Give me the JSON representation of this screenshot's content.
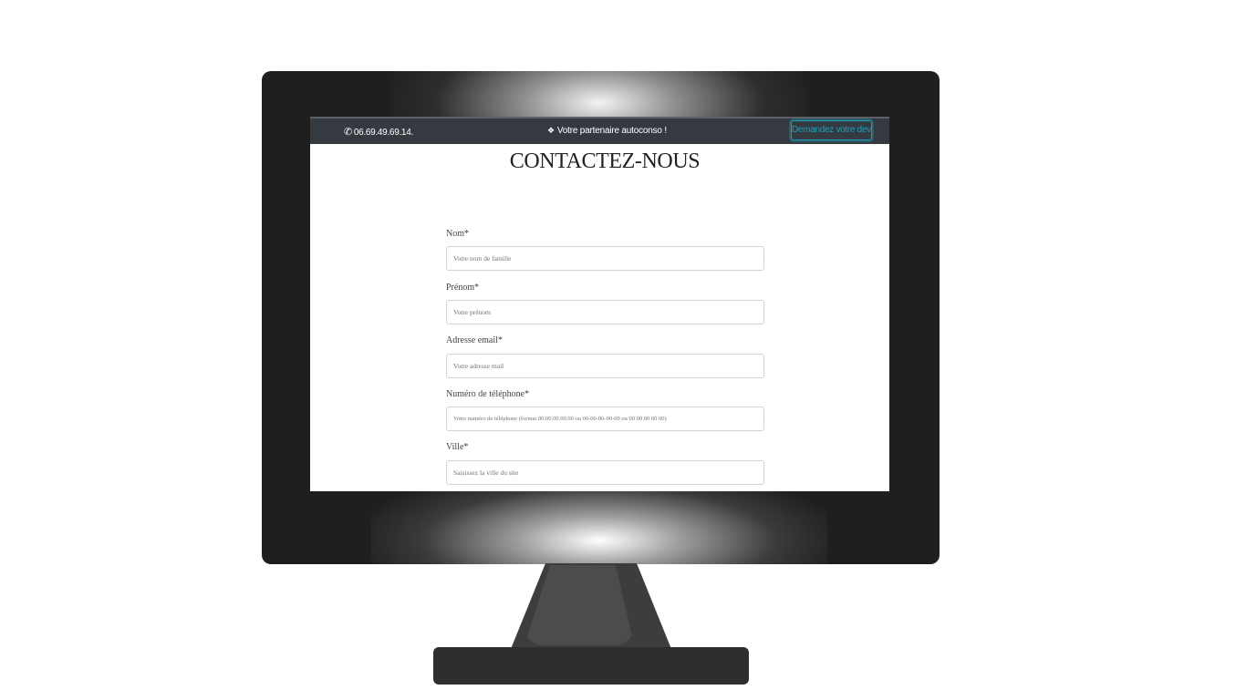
{
  "topbar": {
    "phone_icon": "phone-icon",
    "phone": "06.69.49.69.14.",
    "partner_icon": "handshake-icon",
    "partner": "Votre partenaire autoconso !",
    "devis_button": "Demandez votre devis",
    "accent_color": "#17a2b8",
    "bar_color": "#343a40"
  },
  "page": {
    "title": "CONTACTEZ-NOUS"
  },
  "form": {
    "fields": [
      {
        "label": "Nom*",
        "placeholder": "Votre nom de famille"
      },
      {
        "label": "Prénom*",
        "placeholder": "Votre prénom"
      },
      {
        "label": "Adresse email*",
        "placeholder": "Votre adresse mail"
      },
      {
        "label": "Numéro de téléphone*",
        "placeholder": "Votre numéro de téléphone (format 00.00.00.00.00 ou 00-00-00-00-00 ou 00 00 00 00 00)"
      },
      {
        "label": "Ville*",
        "placeholder": "Saisissez la ville du site"
      }
    ]
  }
}
